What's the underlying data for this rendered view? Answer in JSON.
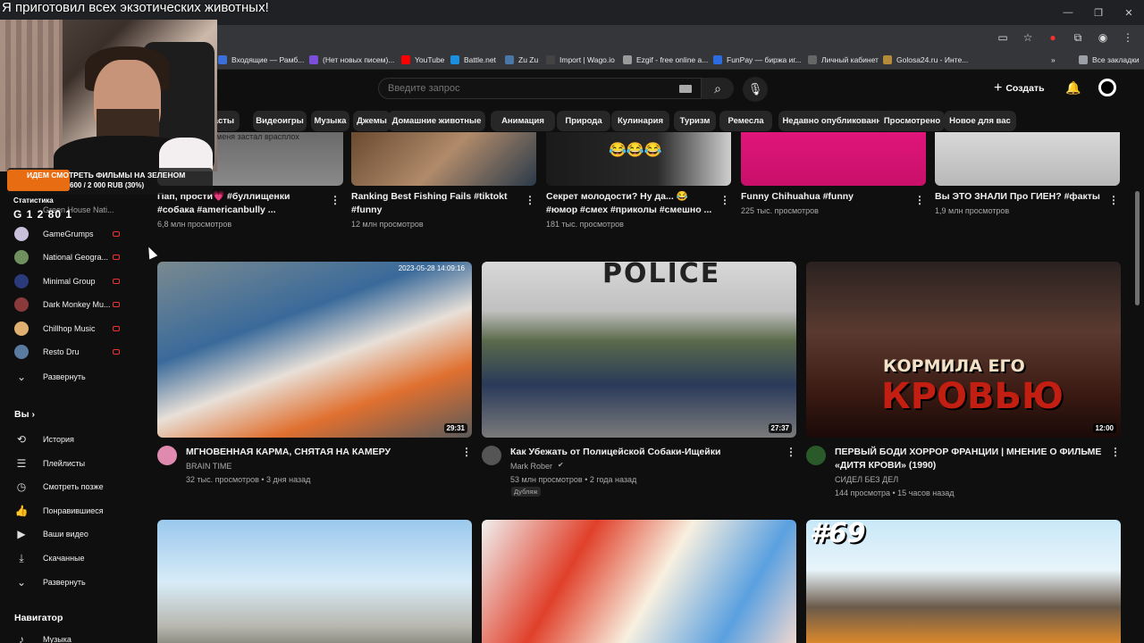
{
  "stream": {
    "title": "Я приготовил всех экзотических животных!"
  },
  "window": {
    "minimize": "—",
    "restore": "❐",
    "close": "✕"
  },
  "bookmarks": [
    {
      "label": "Входящие — Рамб...",
      "color": "#3b6fd9"
    },
    {
      "label": "(Нет новых писем)...",
      "color": "#7b4fd9"
    },
    {
      "label": "YouTube",
      "color": "#ff0000"
    },
    {
      "label": "Battle.net",
      "color": "#1a8fe0"
    },
    {
      "label": "Zu Zu",
      "color": "#4a76a8"
    },
    {
      "label": "Import | Wago.io",
      "color": "#444444"
    },
    {
      "label": "Ezgif - free online a...",
      "color": "#9a9a9a"
    },
    {
      "label": "FunPay — биржа иг...",
      "color": "#2d6be0"
    },
    {
      "label": "Личный кабинет",
      "color": "#666666"
    },
    {
      "label": "Golosa24.ru - Инте...",
      "color": "#b58a3a"
    }
  ],
  "bookmarks_more": "»",
  "bookmarks_all": "Все закладки",
  "header": {
    "search_placeholder": "Введите запрос",
    "create_label": "Создать"
  },
  "chips": [
    "касты",
    "Видеоигры",
    "Музыка",
    "Джемы",
    "Домашние животные",
    "Анимация",
    "Природа",
    "Кулинария",
    "Туризм",
    "Ремесла",
    "Недавно опубликованные",
    "Просмотрено",
    "Новое для вас"
  ],
  "overlay": {
    "promo_line1": "ИДЕМ СМОТРЕТЬ ФИЛЬМЫ НА ЗЕЛЕНОМ",
    "promo_line2": "600 / 2 000 RUB (30%)",
    "stats_label": "Статистика",
    "stats_line": "G  1  2  80  1",
    "overlap_channel": "Green House Nati..."
  },
  "sidebar": {
    "channels": [
      {
        "label": "GameGrumps",
        "color": "#c9c0d9"
      },
      {
        "label": "National Geogra...",
        "color": "#6f8f5f"
      },
      {
        "label": "Minimal Group",
        "color": "#2a3a7a"
      },
      {
        "label": "Dark Monkey Mu...",
        "color": "#8a3a3a"
      },
      {
        "label": "Chillhop Music",
        "color": "#e0b070"
      },
      {
        "label": "Resto Dru",
        "color": "#5a7aa0"
      }
    ],
    "expand_channels": "Развернуть",
    "you_label": "Вы",
    "you_items": [
      "История",
      "Плейлисты",
      "Смотреть позже",
      "Понравившиеся",
      "Ваши видео",
      "Скачанные",
      "Развернуть"
    ],
    "navigator_label": "Навигатор",
    "navigator_items": [
      "Музыка"
    ]
  },
  "top_row": [
    {
      "title_lines": [
        "Пап, прости💗 #буллищенки",
        "#собака #americanbully ..."
      ],
      "meta": [
        "6,8 млн просмотров"
      ],
      "thumb_text": "меня застал врасплох"
    },
    {
      "title_lines": [
        "Ranking Best Fishing Fails #tiktokt",
        "#funny"
      ],
      "meta": [
        "12 млн просмотров"
      ]
    },
    {
      "title_lines": [
        "Секрет молодости? Ну да... 😂",
        "#юмор #смех #приколы #смешно ..."
      ],
      "meta": [
        "181 тыс. просмотров"
      ],
      "thumb_text": "😂😂😂"
    },
    {
      "title_lines": [
        "Funny Chihuahua #funny"
      ],
      "meta": [
        "225 тыс. просмотров"
      ]
    },
    {
      "title_lines": [
        "Вы ЭТО ЗНАЛИ Про ГИЕН? #факты"
      ],
      "meta": [
        "1,9 млн просмотров"
      ]
    }
  ],
  "videos": [
    {
      "title_lines": [
        "МГНОВЕННАЯ КАРМА, СНЯТАЯ НА КАМЕРУ"
      ],
      "channel": "BRAIN TIME",
      "meta": "32 тыс. просмотров • 3 дня назад",
      "duration": "29:31",
      "avatar_color": "#e08ab0",
      "verified": false,
      "badge": "",
      "thumb_timestamp": "2023-05-28 14:09:16"
    },
    {
      "title_lines": [
        "Как Убежать от Полицейской Собаки-Ищейки"
      ],
      "channel": "Mark Rober",
      "meta": "53 млн просмотров • 2 года назад",
      "duration": "27:37",
      "avatar_color": "#555555",
      "verified": true,
      "badge": "Дубляж",
      "thumb_text": "POLICE"
    },
    {
      "title_lines": [
        "ПЕРВЫЙ БОДИ ХОРРОР ФРАНЦИИ | МНЕНИЕ О ФИЛЬМЕ",
        "«ДИТЯ КРОВИ» (1990)"
      ],
      "channel": "СИДЕЛ БЕЗ ДЕЛ",
      "meta": "144 просмотра • 15 часов назад",
      "duration": "12:00",
      "avatar_color": "#2a5a2a",
      "verified": false,
      "badge": "",
      "thumb_line1": "КОРМИЛА ЕГО",
      "thumb_line2": "КРОВЬЮ"
    }
  ],
  "bottom_row": [
    {
      "thumb_text": ""
    },
    {
      "thumb_text": ""
    },
    {
      "thumb_text": "#69"
    }
  ]
}
